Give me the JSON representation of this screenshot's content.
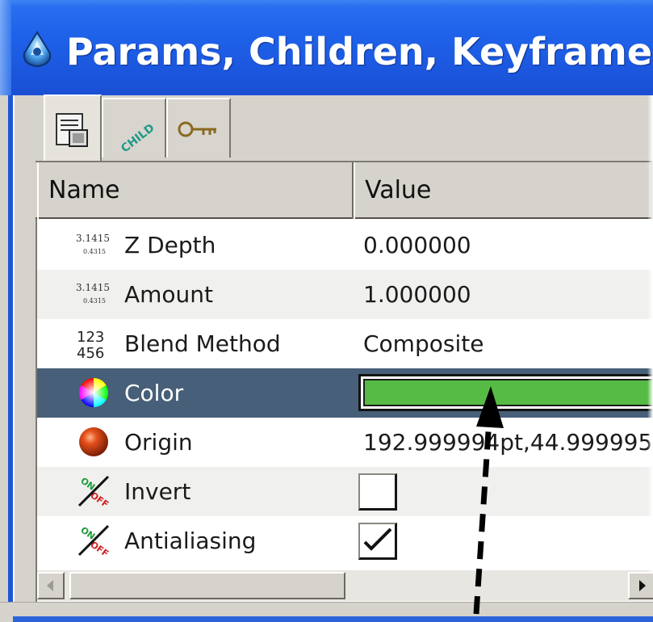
{
  "window": {
    "title": "Params, Children, Keyframe"
  },
  "tabs": [
    {
      "name": "params",
      "icon": "params-icon",
      "active": true
    },
    {
      "name": "children",
      "icon": "child-icon",
      "label": "CHILD",
      "active": false
    },
    {
      "name": "keyframes",
      "icon": "key-icon",
      "active": false
    }
  ],
  "table": {
    "columns": [
      "Name",
      "Value"
    ],
    "rows": [
      {
        "name": "Z Depth",
        "value": "0.000000",
        "icon": "real-number-icon",
        "icon_top": "3.1415",
        "icon_bottom": "0.4315"
      },
      {
        "name": "Amount",
        "value": "1.000000",
        "icon": "real-number-icon",
        "icon_top": "3.1415",
        "icon_bottom": "0.4315"
      },
      {
        "name": "Blend Method",
        "value": "Composite",
        "icon": "integer-icon",
        "icon_top": "123",
        "icon_bottom": "456"
      },
      {
        "name": "Color",
        "value": "",
        "icon": "color-wheel-icon",
        "selected": true,
        "swatch": "#55bb44"
      },
      {
        "name": "Origin",
        "value": "192.999994pt,44.999995",
        "icon": "origin-sphere-icon"
      },
      {
        "name": "Invert",
        "value": "",
        "icon": "boolean-icon",
        "checked": false,
        "icon_on": "ON",
        "icon_off": "OFF"
      },
      {
        "name": "Antialiasing",
        "value": "",
        "icon": "boolean-icon",
        "checked": true,
        "icon_on": "ON",
        "icon_off": "OFF"
      }
    ]
  },
  "colors": {
    "title_bar": "#1f5fe6",
    "selection": "#475f78",
    "swatch_green": "#55bb44"
  }
}
